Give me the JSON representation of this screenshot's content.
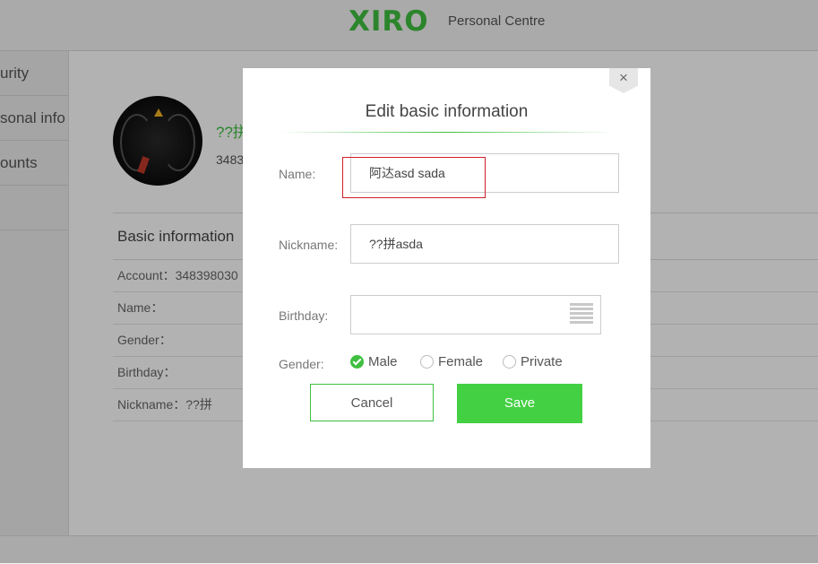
{
  "header": {
    "logo": "XIRO",
    "title": "Personal Centre"
  },
  "sidebar": {
    "items": [
      {
        "label": "urity"
      },
      {
        "label": "sonal info"
      },
      {
        "label": "ounts"
      }
    ]
  },
  "profile": {
    "name_partial": "??拼",
    "id_partial": "3483"
  },
  "info": {
    "heading": "Basic information",
    "rows": [
      {
        "text": "Account：348398030"
      },
      {
        "text": "Name："
      },
      {
        "text": "Gender："
      },
      {
        "text": "Birthday："
      },
      {
        "text": "Nickname：??拼"
      }
    ]
  },
  "modal": {
    "close_glyph": "×",
    "title": "Edit basic information",
    "name_label": "Name:",
    "name_value": "阿达asd sada",
    "nickname_label": "Nickname:",
    "nickname_value": "??拼asda",
    "birthday_label": "Birthday:",
    "birthday_value": "",
    "gender_label": "Gender:",
    "gender_options": [
      {
        "label": "Male",
        "checked": true
      },
      {
        "label": "Female",
        "checked": false
      },
      {
        "label": "Private",
        "checked": false
      }
    ],
    "cancel_label": "Cancel",
    "save_label": "Save"
  },
  "icons": {
    "close": "close-icon",
    "calendar": "calendar-icon",
    "avatar": "dashboard-photo"
  },
  "colors": {
    "brand_green": "#3fbf3f",
    "save_button": "#43d043",
    "highlight_box": "#d0202a"
  }
}
